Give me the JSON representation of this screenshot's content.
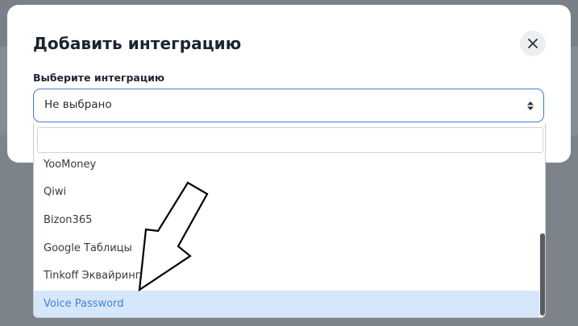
{
  "modal": {
    "title": "Добавить интеграцию",
    "close_icon": "close-icon",
    "field_label": "Выберите интеграцию",
    "select_value": "Не выбрано",
    "select_icon": "sort-arrows-icon"
  },
  "dropdown": {
    "search_placeholder": "",
    "items": [
      {
        "label": "YooMoney"
      },
      {
        "label": "Qiwi"
      },
      {
        "label": "Bizon365"
      },
      {
        "label": "Google Таблицы"
      },
      {
        "label": "Tinkoff Эквайринг"
      },
      {
        "label": "Voice Password",
        "highlighted": true
      }
    ]
  },
  "annotation": {
    "icon": "pointer-arrow-icon"
  },
  "colors": {
    "accent": "#3d7fd8",
    "highlight_bg": "#d6e6fb",
    "highlight_text": "#3f86d8",
    "overlay": "#7a8088"
  }
}
